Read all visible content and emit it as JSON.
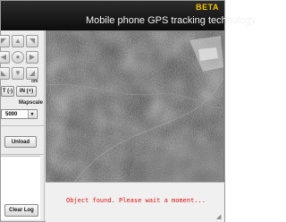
{
  "header": {
    "beta": "BETA",
    "title": "Mobile phone GPS tracking technology"
  },
  "controls": {
    "zoom_label": "om",
    "zoom_out": "T (-)",
    "zoom_in": "IN (+)",
    "mapscale_label": "Mapscale",
    "mapscale_value": "5000",
    "unload": "Unload",
    "clear_log": "Clear Log"
  },
  "icons": {
    "up": "arrow-up-icon",
    "down": "arrow-down-icon",
    "left": "arrow-left-icon",
    "right": "arrow-right-icon",
    "center": "center-icon"
  },
  "status": {
    "message": "Object found. Please wait a moment..."
  },
  "colors": {
    "header": "#141414",
    "beta": "#f5c400",
    "status": "#e01010"
  }
}
